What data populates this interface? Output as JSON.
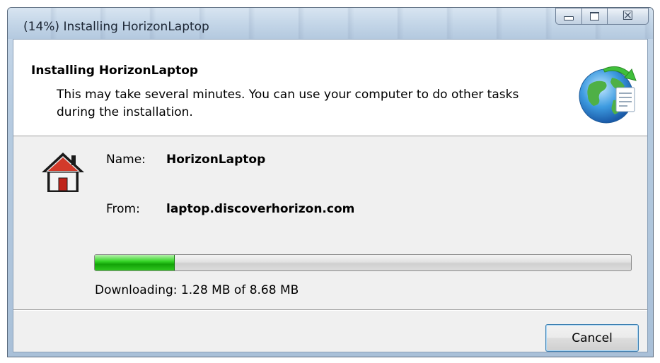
{
  "window": {
    "title": "(14%) Installing HorizonLaptop",
    "buttons": {
      "minimize_icon": "minimize-icon",
      "maximize_icon": "maximize-icon",
      "close_glyph": "☒"
    }
  },
  "header": {
    "title": "Installing HorizonLaptop",
    "description": "This may take several minutes. You can use your computer to do other tasks during the installation.",
    "icon": "globe-installer-icon"
  },
  "details": {
    "icon": "house-icon",
    "name_label": "Name:",
    "name_value": "HorizonLaptop",
    "from_label": "From:",
    "from_value": "laptop.discoverhorizon.com"
  },
  "progress": {
    "fraction": 0.1475,
    "status": "Downloading: 1.28 MB of 8.68 MB"
  },
  "footer": {
    "cancel_label": "Cancel"
  },
  "colors": {
    "progress_green": "#13a308",
    "window_frame": "#b6cbe0",
    "button_focus_border": "#3c7fb1"
  }
}
